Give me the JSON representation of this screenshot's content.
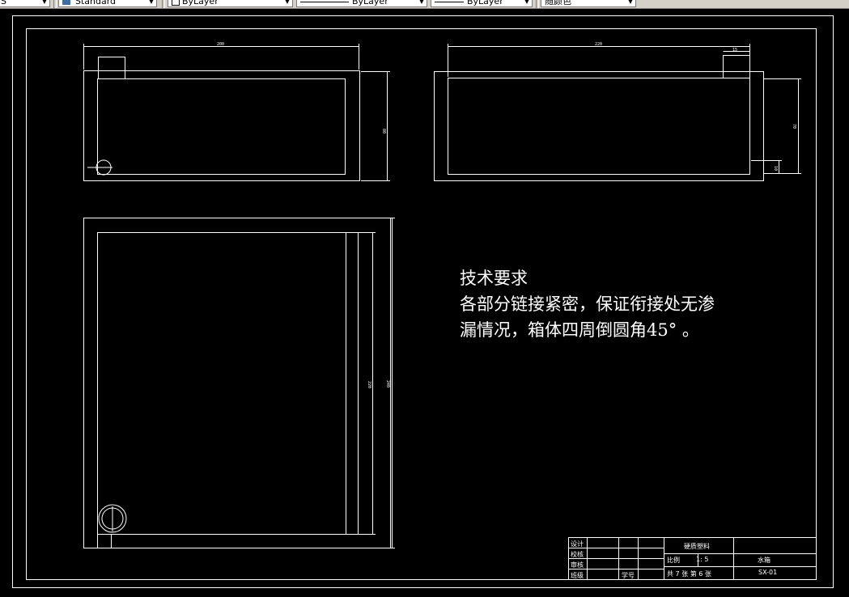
{
  "toolbar": {
    "field0_value": "S",
    "style_value": "Standard",
    "layer_value": "ByLayer",
    "linetype_value": "ByLayer",
    "lineweight_value": "ByLayer",
    "color_value": "随颜色"
  },
  "drawing": {
    "dims": {
      "front_width": "200",
      "front_height": "80",
      "side_width": "220",
      "side_top": "15",
      "side_height": "70",
      "side_small": "10",
      "plan_inner": "220",
      "plan_outer": "240"
    },
    "requirements": {
      "title": "技术要求",
      "line1": "各部分链接紧密，保证衔接处无渗",
      "line2": "漏情况，箱体四周倒圆角45°  。"
    },
    "title_block": {
      "design": "设计",
      "check": "校核",
      "review": "审核",
      "class": "班级",
      "student_no": "学号",
      "material": "硬质塑料",
      "scale_label": "比例",
      "scale_value": "1: 5",
      "name": "水箱",
      "sheets": "共 7  张 第 6  张",
      "code": "SX-01"
    }
  }
}
